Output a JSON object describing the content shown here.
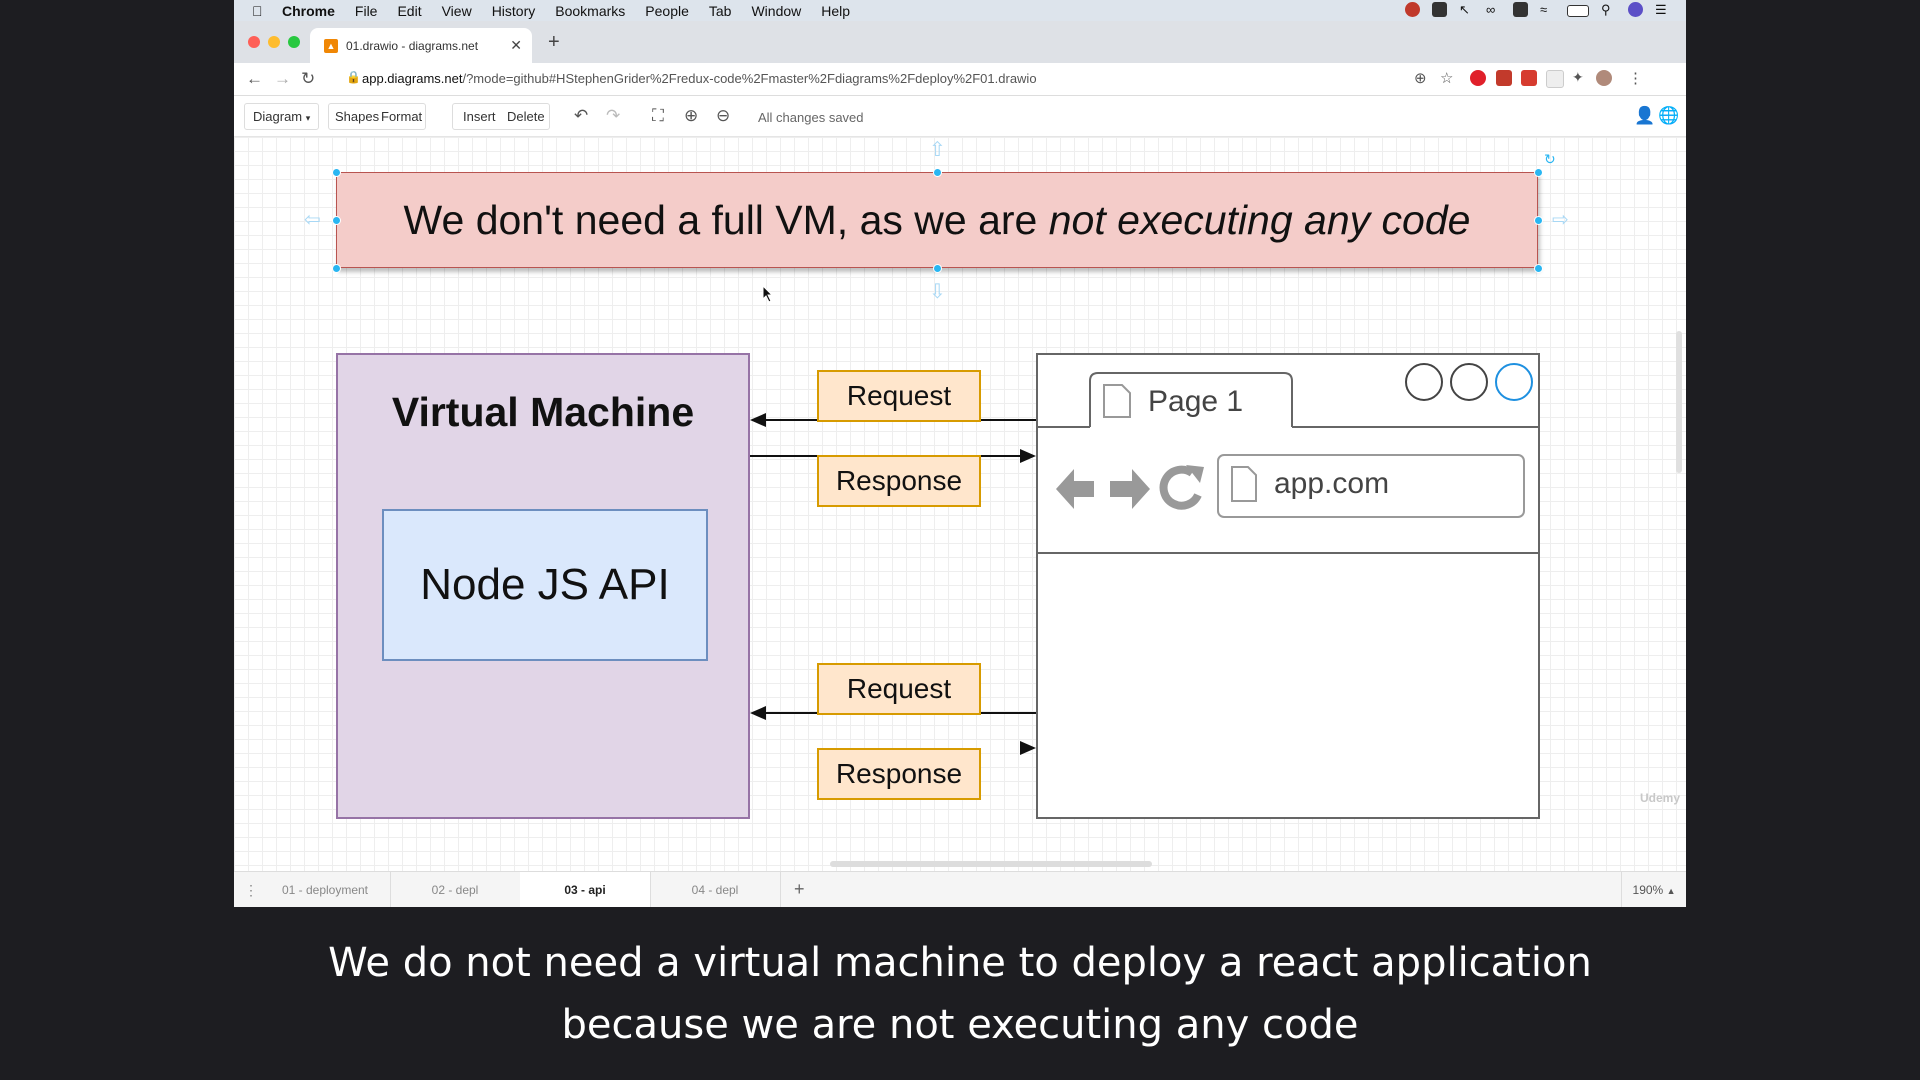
{
  "menubar": {
    "apple_icon": "apple-logo-icon",
    "items": [
      "Chrome",
      "File",
      "Edit",
      "View",
      "History",
      "Bookmarks",
      "People",
      "Tab",
      "Window",
      "Help"
    ]
  },
  "browser_chrome": {
    "tab_title": "01.drawio - diagrams.net",
    "url_host": "app.diagrams.net",
    "url_rest": "/?mode=github#HStephenGrider%2Fredux-code%2Fmaster%2Fdiagrams%2Fdeploy%2F01.drawio"
  },
  "drawio_toolbar": {
    "diagram_menu": "Diagram",
    "shapes": "Shapes",
    "format": "Format",
    "insert": "Insert",
    "delete": "Delete",
    "status": "All changes saved"
  },
  "diagram": {
    "banner_plain": "We don't need a full VM, as we are ",
    "banner_italic": "not executing any code",
    "vm_title": "Virtual Machine",
    "api_label": "Node JS API",
    "request_label": "Request",
    "response_label": "Response",
    "browser_tab": "Page 1",
    "browser_url": "app.com",
    "watermark": "Udemy"
  },
  "pages": {
    "tabs": [
      "01 - deployment",
      "02 - depl",
      "03 - api",
      "04 - depl"
    ],
    "active": "03 - api",
    "zoom": "190%"
  },
  "subtitles": {
    "line1": "We do not need a virtual machine to deploy a react application",
    "line2": "because we are not executing any code"
  },
  "colors": {
    "banner_fill": "#f4ccc9",
    "vm_fill": "#e1d5e7",
    "api_fill": "#dae8fc",
    "label_fill": "#ffe6cc",
    "selection": "#29b6f2"
  }
}
